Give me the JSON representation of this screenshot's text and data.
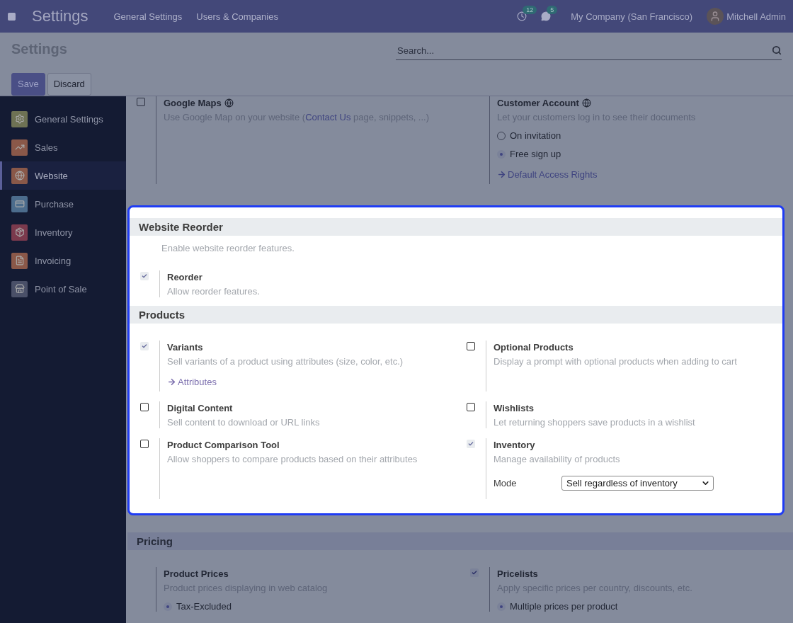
{
  "navbar": {
    "app_title": "Settings",
    "menu": [
      "General Settings",
      "Users & Companies"
    ],
    "activity_count": "12",
    "message_count": "5",
    "company": "My Company (San Francisco)",
    "user": "Mitchell Admin"
  },
  "control_panel": {
    "title": "Settings",
    "search": {
      "placeholder": "Search..."
    },
    "buttons": [
      {
        "label": "Save",
        "primary": true
      },
      {
        "label": "Discard",
        "primary": false
      }
    ]
  },
  "sidebar": {
    "items": [
      {
        "label": "General Settings",
        "selected": false,
        "color": "#6e7254",
        "kind": "gear"
      },
      {
        "label": "Sales",
        "selected": false,
        "color": "#8a5849",
        "kind": "chart"
      },
      {
        "label": "Website",
        "selected": true,
        "color": "#8a5849",
        "kind": "globe"
      },
      {
        "label": "Purchase",
        "selected": false,
        "color": "#4c6c8c",
        "kind": "card"
      },
      {
        "label": "Inventory",
        "selected": false,
        "color": "#7b3a4d",
        "kind": "box"
      },
      {
        "label": "Invoicing",
        "selected": false,
        "color": "#8a5849",
        "kind": "invoice"
      },
      {
        "label": "Point of Sale",
        "selected": false,
        "color": "#4a5068",
        "kind": "store"
      }
    ]
  },
  "sections": [
    {
      "highlighted": false,
      "settings": [
        {
          "title": "Google Maps",
          "checked": false,
          "info_icon": true,
          "description": "Use Google Map on your website (",
          "description_link": "Contact Us",
          "description_after": " page, snippets, ...)"
        },
        {
          "title": "Customer Account",
          "info_icon": true,
          "description": "Let your customers log in to see their documents",
          "options": [
            {
              "label": "On invitation",
              "selected": false
            },
            {
              "label": "Free sign up",
              "selected": true
            }
          ],
          "link": "Default Access Rights"
        }
      ]
    },
    {
      "highlighted": true,
      "title": "Website Reorder",
      "description": "Enable website reorder features.",
      "settings": [
        {
          "title": "Reorder",
          "checked": true,
          "description": "Allow reorder features."
        }
      ]
    },
    {
      "highlighted": true,
      "title": "Products",
      "settings": [
        {
          "title": "Variants",
          "checked": true,
          "description": "Sell variants of a product using attributes (size, color, etc.)",
          "link": "Attributes"
        },
        {
          "title": "Optional Products",
          "checked": false,
          "description": "Display a prompt with optional products when adding to cart"
        },
        {
          "title": "Digital Content",
          "checked": false,
          "description": "Sell content to download or URL links"
        },
        {
          "title": "Wishlists",
          "checked": false,
          "description": "Let returning shoppers save products in a wishlist"
        },
        {
          "title": "Product Comparison Tool",
          "checked": false,
          "description": "Allow shoppers to compare products based on their attributes"
        },
        {
          "title": "Inventory",
          "checked": true,
          "description": "Manage availability of products",
          "field": {
            "label": "Mode",
            "value": "Sell regardless of inventory"
          }
        }
      ]
    },
    {
      "highlighted": false,
      "title": "Pricing",
      "settings": [
        {
          "title": "Product Prices",
          "description": "Product prices displaying in web catalog",
          "options": [
            {
              "label": "Tax-Excluded",
              "selected": true
            }
          ]
        },
        {
          "title": "Pricelists",
          "checked": true,
          "description": "Apply specific prices per country, discounts, etc.",
          "options": [
            {
              "label": "Multiple prices per product",
              "selected": true
            }
          ]
        }
      ]
    }
  ]
}
